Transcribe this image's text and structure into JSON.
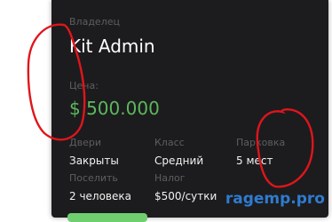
{
  "property": {
    "owner_label": "Владелец",
    "owner_value": "Kit Admin",
    "price_label": "Цена:",
    "price_value": "$ 500.000",
    "doors_label": "Двери",
    "doors_value": "Закрыты",
    "class_label": "Класс",
    "class_value": "Средний",
    "parking_label": "Парковка",
    "parking_value": "5 мест",
    "settle_label": "Поселить",
    "settle_value": "2 человека",
    "tax_label": "Налог",
    "tax_value": "$500/сутки"
  },
  "watermark": "ragemp.pro",
  "colors": {
    "card_bg": "#1c1c1e",
    "price": "#5cb85c",
    "annotation": "#e0151b",
    "watermark": "#2f7bd0"
  }
}
